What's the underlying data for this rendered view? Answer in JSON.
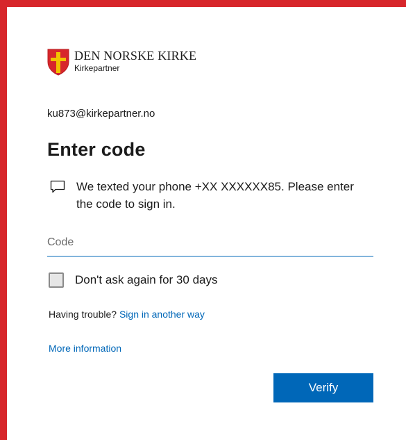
{
  "brand": {
    "name": "DEN NORSKE KIRKE",
    "subtitle": "Kirkepartner",
    "logo_icon": "church-shield-icon"
  },
  "account": {
    "email": "ku873@kirkepartner.no"
  },
  "page": {
    "title": "Enter code"
  },
  "message": {
    "icon": "chat-bubble-icon",
    "text": "We texted your phone +XX XXXXXX85. Please enter the code to sign in."
  },
  "code_field": {
    "placeholder": "Code",
    "value": ""
  },
  "remember": {
    "label": "Don't ask again for 30 days",
    "checked": false
  },
  "trouble": {
    "prefix": "Having trouble?",
    "link": "Sign in another way"
  },
  "more_info": {
    "link": "More information"
  },
  "actions": {
    "verify_label": "Verify"
  },
  "colors": {
    "frame": "#d7262b",
    "accent": "#0067b8",
    "card": "#ffffff"
  }
}
